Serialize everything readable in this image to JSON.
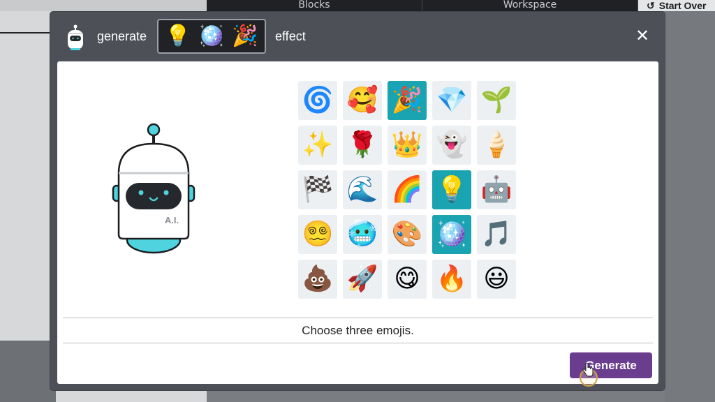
{
  "background": {
    "tabs": [
      "Blocks",
      "Workspace"
    ],
    "start_over_label": "Start Over",
    "undo_icon": "↺"
  },
  "modal": {
    "header": {
      "generate_text": "generate",
      "effect_text": "effect",
      "selected_emojis": [
        "💡",
        "🪩",
        "🎉"
      ],
      "close_icon": "✕"
    },
    "emoji_grid": [
      {
        "emoji": "🌀",
        "selected": false
      },
      {
        "emoji": "🥰",
        "selected": false
      },
      {
        "emoji": "🎉",
        "selected": true
      },
      {
        "emoji": "💎",
        "selected": false
      },
      {
        "emoji": "🌱",
        "selected": false
      },
      {
        "emoji": "✨",
        "selected": false
      },
      {
        "emoji": "🌹",
        "selected": false
      },
      {
        "emoji": "👑",
        "selected": false
      },
      {
        "emoji": "👻",
        "selected": false
      },
      {
        "emoji": "🍦",
        "selected": false
      },
      {
        "emoji": "🏁",
        "selected": false
      },
      {
        "emoji": "🌊",
        "selected": false
      },
      {
        "emoji": "🌈",
        "selected": false
      },
      {
        "emoji": "💡",
        "selected": true
      },
      {
        "emoji": "🤖",
        "selected": false
      },
      {
        "emoji": "😵‍💫",
        "selected": false
      },
      {
        "emoji": "🥶",
        "selected": false
      },
      {
        "emoji": "🎨",
        "selected": false
      },
      {
        "emoji": "🪩",
        "selected": true
      },
      {
        "emoji": "🎵",
        "selected": false
      },
      {
        "emoji": "💩",
        "selected": false
      },
      {
        "emoji": "🚀",
        "selected": false
      },
      {
        "emoji": "😋",
        "selected": false
      },
      {
        "emoji": "🔥",
        "selected": false
      },
      {
        "emoji": "😃",
        "selected": false
      }
    ],
    "robot_label": "A.I.",
    "prompt": "Choose three emojis.",
    "generate_button": "Generate"
  },
  "colors": {
    "accent_teal": "#1aa3b0",
    "button_purple": "#6a3d8f",
    "modal_frame": "#4d5157"
  }
}
